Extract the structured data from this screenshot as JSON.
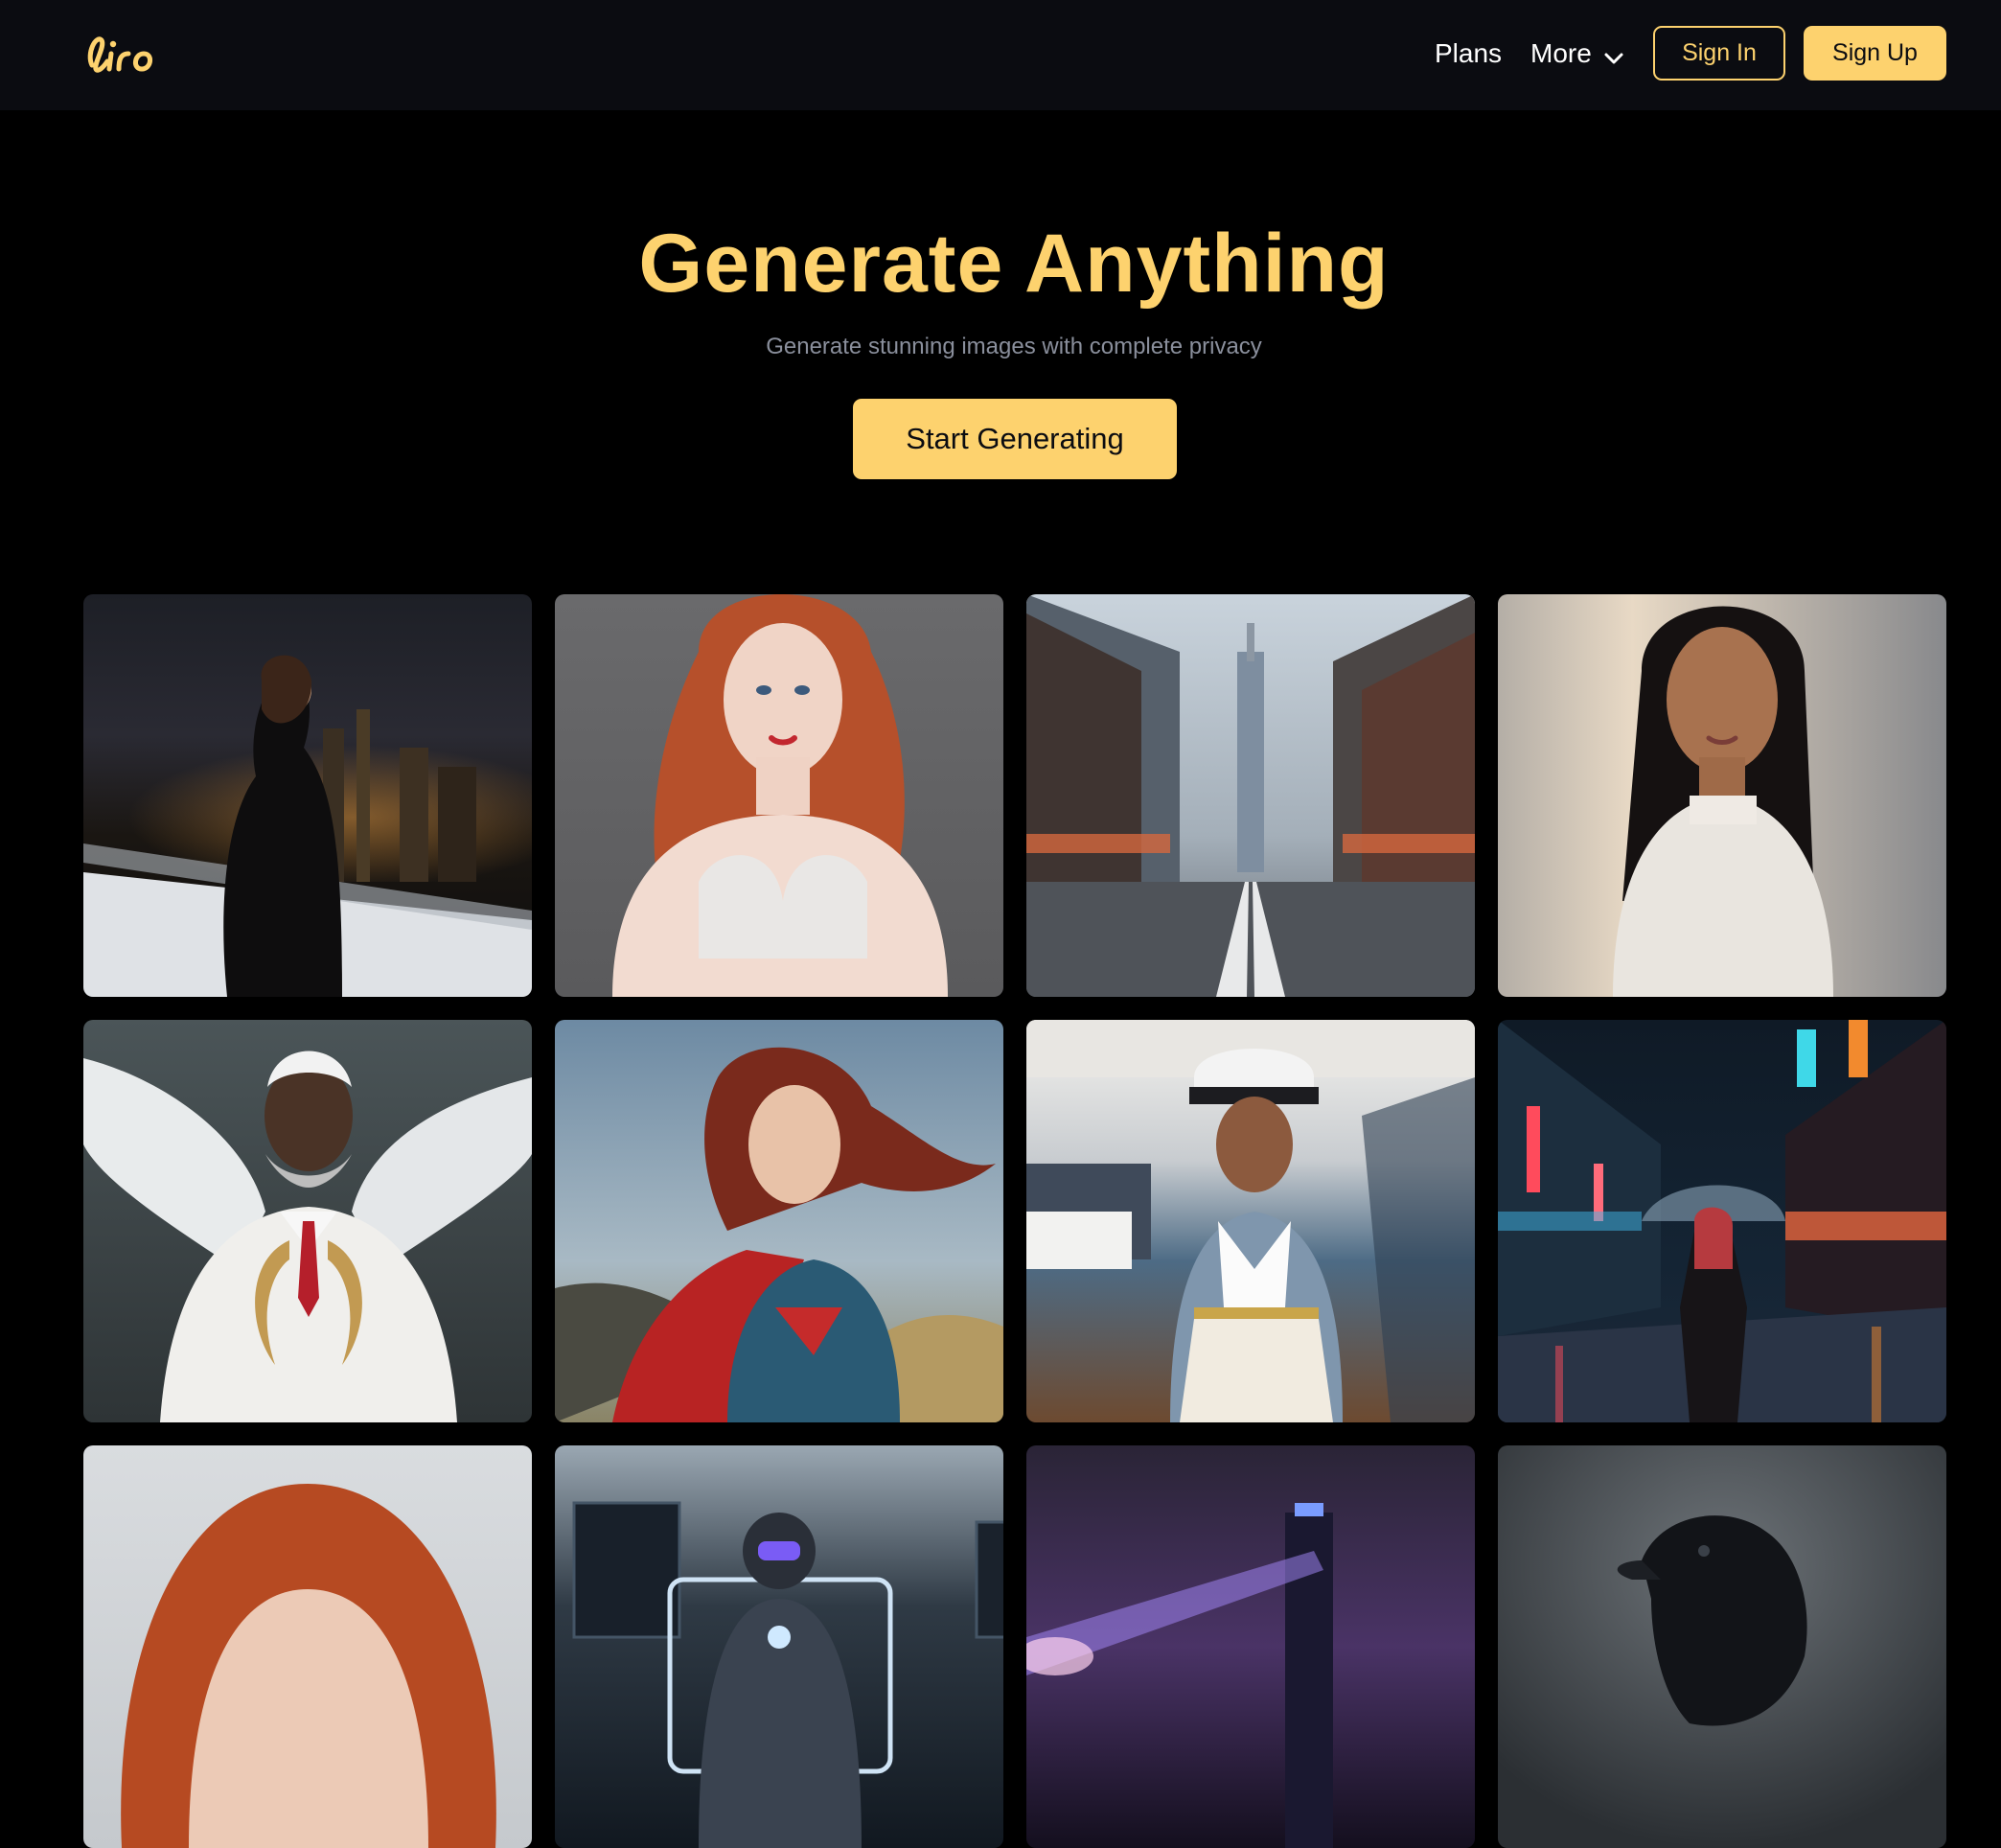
{
  "header": {
    "logo_text": "liro",
    "nav": {
      "plans_label": "Plans",
      "more_label": "More"
    },
    "sign_in_label": "Sign In",
    "sign_up_label": "Sign Up"
  },
  "hero": {
    "title": "Generate Anything",
    "subtitle": "Generate stunning images with complete privacy",
    "cta_label": "Start Generating"
  },
  "gallery": {
    "tiles": [
      {
        "subject": "woman-on-rooftop-city-night"
      },
      {
        "subject": "red-haired-woman-portrait"
      },
      {
        "subject": "japanese-street-tower"
      },
      {
        "subject": "woman-white-top-portrait"
      },
      {
        "subject": "angel-man-white-suit"
      },
      {
        "subject": "superhero-woman-red-cape"
      },
      {
        "subject": "captain-woman-on-yacht"
      },
      {
        "subject": "woman-umbrella-neon-street"
      },
      {
        "subject": "red-haired-woman-closeup"
      },
      {
        "subject": "robot-in-lab"
      },
      {
        "subject": "neon-tower-laser"
      },
      {
        "subject": "raven-portrait"
      }
    ]
  },
  "colors": {
    "accent": "#fdd26e",
    "topbar_bg": "#0b0c11",
    "page_bg": "#000000",
    "subtitle": "#8a8f9c"
  }
}
